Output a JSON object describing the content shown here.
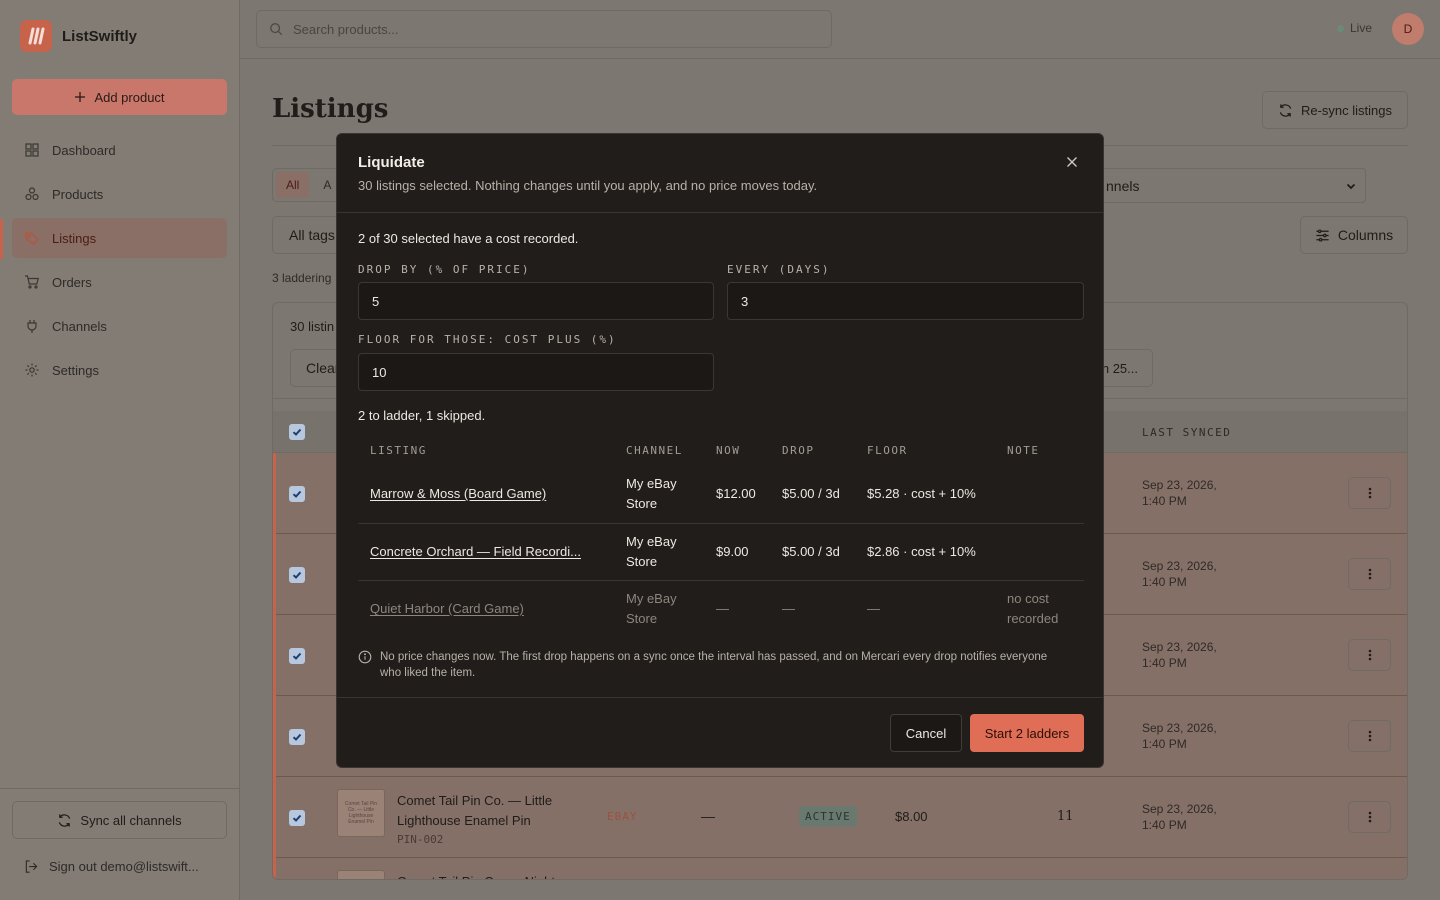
{
  "app": {
    "name": "ListSwiftly"
  },
  "sidebar": {
    "add_product": "Add product",
    "items": [
      {
        "label": "Dashboard",
        "icon": "dashboard-icon"
      },
      {
        "label": "Products",
        "icon": "boxes-icon"
      },
      {
        "label": "Listings",
        "icon": "tag-icon",
        "active": true
      },
      {
        "label": "Orders",
        "icon": "cart-icon"
      },
      {
        "label": "Channels",
        "icon": "plug-icon"
      },
      {
        "label": "Settings",
        "icon": "gear-icon"
      }
    ],
    "sync_all": "Sync all channels",
    "sign_out": "Sign out demo@listswift..."
  },
  "topbar": {
    "search_placeholder": "Search products...",
    "status": "Live",
    "avatar_initial": "D"
  },
  "main": {
    "title": "Listings",
    "resync": "Re-sync listings",
    "tabs": [
      "All",
      "A"
    ],
    "channels_filter": "nnels",
    "tags_filter": "All tags",
    "columns": "Columns",
    "laddering_note": "3 laddering",
    "bulk_count": "30 listin",
    "bulk_clear": "Clear",
    "bulk_other": "n 25...",
    "last_synced_header": "LAST SYNCED",
    "rows": [
      {
        "synced": "Sep 23, 2026, 1:40 PM"
      },
      {
        "synced": "Sep 23, 2026, 1:40 PM"
      },
      {
        "synced": "Sep 23, 2026, 1:40 PM"
      },
      {
        "synced": "Sep 23, 2026, 1:40 PM"
      },
      {
        "title": "Comet Tail Pin Co. — Little Lighthouse Enamel Pin",
        "sku": "PIN-002",
        "channel": "EBAY",
        "dash": "—",
        "status": "ACTIVE",
        "price": "$8.00",
        "qty": "11",
        "synced": "Sep 23, 2026, 1:40 PM"
      },
      {
        "title": "Comet Tail Pin Co. — Night"
      }
    ]
  },
  "modal": {
    "title": "Liquidate",
    "subtitle": "30 listings selected. Nothing changes until you apply, and no price moves today.",
    "cost_note": "2 of 30 selected have a cost recorded.",
    "drop_label": "DROP BY (% OF PRICE)",
    "drop_value": "5",
    "every_label": "EVERY (DAYS)",
    "every_value": "3",
    "floor_label": "FLOOR FOR THOSE: COST PLUS (%)",
    "floor_value": "10",
    "summary": "2 to ladder, 1 skipped.",
    "columns": [
      "LISTING",
      "CHANNEL",
      "NOW",
      "DROP",
      "FLOOR",
      "NOTE"
    ],
    "rows": [
      {
        "listing": "Marrow & Moss (Board Game)",
        "channel": "My eBay Store",
        "now": "$12.00",
        "drop": "$5.00 / 3d",
        "floor": "$5.28 · cost + 10%",
        "note": ""
      },
      {
        "listing": "Concrete Orchard — Field Recordi...",
        "channel": "My eBay Store",
        "now": "$9.00",
        "drop": "$5.00 / 3d",
        "floor": "$2.86 · cost + 10%",
        "note": ""
      },
      {
        "listing": "Quiet Harbor (Card Game)",
        "channel": "My eBay Store",
        "now": "—",
        "drop": "—",
        "floor": "—",
        "note": "no cost recorded"
      }
    ],
    "info": "No price changes now. The first drop happens on a sync once the interval has passed, and on Mercari every drop notifies everyone who liked the item.",
    "cancel": "Cancel",
    "start": "Start 2 ladders"
  }
}
